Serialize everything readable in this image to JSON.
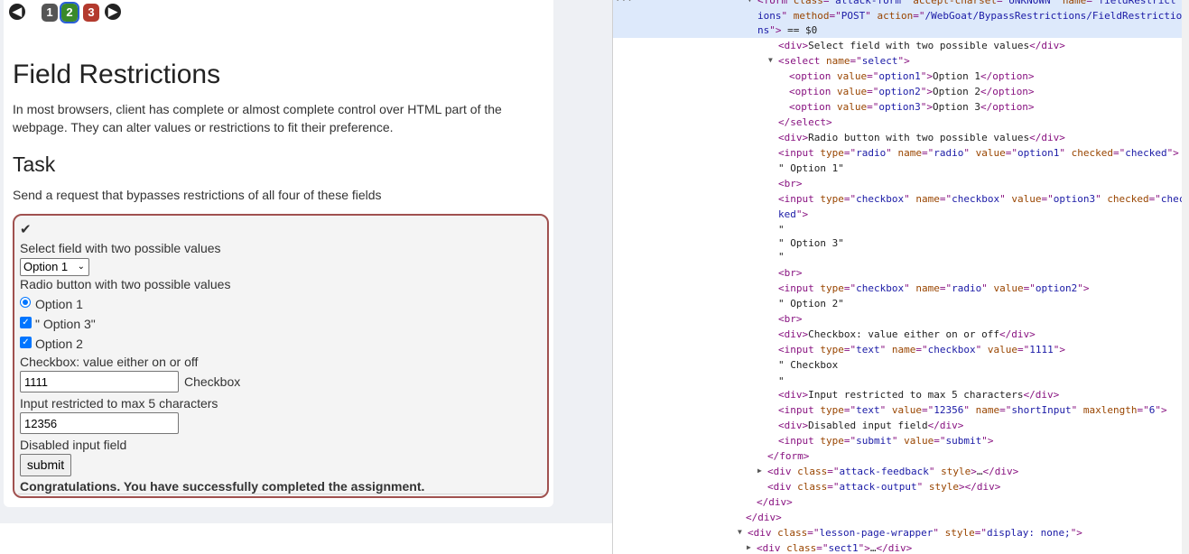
{
  "lesson": {
    "pages": [
      "1",
      "2",
      "3"
    ],
    "title": "Field Restrictions",
    "intro": "In most browsers, client has complete or almost complete control over HTML part of the webpage. They can alter values or restrictions to fit their preference.",
    "task_heading": "Task",
    "task_desc": "Send a request that bypasses restrictions of all four of these fields"
  },
  "form": {
    "check_mark": "✔",
    "select_label": "Select field with two possible values",
    "select_value": "Option 1",
    "radio_label": "Radio button with two possible values",
    "radio_option_label": "Option 1",
    "checkbox1_label": "\" Option 3\"",
    "checkbox2_label": "Option 2",
    "text_label": "Checkbox: value either on or off",
    "text_value": "1111",
    "text_suffix": "Checkbox",
    "short_label": "Input restricted to max 5 characters",
    "short_value": "12356",
    "disabled_label": "Disabled input field",
    "submit_label": "submit",
    "feedback": "Congratulations. You have successfully completed the assignment."
  },
  "devtools": {
    "lines": [
      {
        "p": [
          [
            "tg",
            "<form "
          ],
          [
            "an",
            "class"
          ],
          [
            "tg",
            "=\""
          ],
          [
            "av",
            "attack-form"
          ],
          [
            "tg",
            "\" "
          ],
          [
            "an",
            "accept-charset"
          ],
          [
            "tg",
            "=\""
          ],
          [
            "av",
            "UNKNOWN"
          ],
          [
            "tg",
            "\" "
          ],
          [
            "an",
            "name"
          ],
          [
            "tg",
            "=\""
          ],
          [
            "av",
            "fieldRestrict"
          ]
        ]
      },
      {
        "p": [
          [
            "av",
            "ions"
          ],
          [
            "tg",
            "\" "
          ],
          [
            "an",
            "method"
          ],
          [
            "tg",
            "=\""
          ],
          [
            "av",
            "POST"
          ],
          [
            "tg",
            "\" "
          ],
          [
            "an",
            "action"
          ],
          [
            "tg",
            "=\""
          ],
          [
            "av",
            "/WebGoat/BypassRestrictions/FieldRestrictio"
          ]
        ]
      },
      {
        "p": [
          [
            "av",
            "ns"
          ],
          [
            "tg",
            "\">"
          ],
          [
            "tx",
            " == $0"
          ]
        ]
      },
      {
        "p": [
          [
            "tg",
            "<div>"
          ],
          [
            "tx",
            "Select field with two possible values"
          ],
          [
            "tg",
            "</div>"
          ]
        ]
      },
      {
        "p": [
          [
            "tg",
            "<select "
          ],
          [
            "an",
            "name"
          ],
          [
            "tg",
            "=\""
          ],
          [
            "av",
            "select"
          ],
          [
            "tg",
            "\">"
          ]
        ]
      },
      {
        "p": [
          [
            "tg",
            "<option "
          ],
          [
            "an",
            "value"
          ],
          [
            "tg",
            "=\""
          ],
          [
            "av",
            "option1"
          ],
          [
            "tg",
            "\">"
          ],
          [
            "tx",
            "Option 1"
          ],
          [
            "tg",
            "</option>"
          ]
        ]
      },
      {
        "p": [
          [
            "tg",
            "<option "
          ],
          [
            "an",
            "value"
          ],
          [
            "tg",
            "=\""
          ],
          [
            "av",
            "option2"
          ],
          [
            "tg",
            "\">"
          ],
          [
            "tx",
            "Option 2"
          ],
          [
            "tg",
            "</option>"
          ]
        ]
      },
      {
        "p": [
          [
            "tg",
            "<option "
          ],
          [
            "an",
            "value"
          ],
          [
            "tg",
            "=\""
          ],
          [
            "av",
            "option3"
          ],
          [
            "tg",
            "\">"
          ],
          [
            "tx",
            "Option 3"
          ],
          [
            "tg",
            "</option>"
          ]
        ]
      },
      {
        "p": [
          [
            "tg",
            "</select>"
          ]
        ]
      },
      {
        "p": [
          [
            "tg",
            "<div>"
          ],
          [
            "tx",
            "Radio button with two possible values"
          ],
          [
            "tg",
            "</div>"
          ]
        ]
      },
      {
        "p": [
          [
            "tg",
            "<input "
          ],
          [
            "an",
            "type"
          ],
          [
            "tg",
            "=\""
          ],
          [
            "av",
            "radio"
          ],
          [
            "tg",
            "\" "
          ],
          [
            "an",
            "name"
          ],
          [
            "tg",
            "=\""
          ],
          [
            "av",
            "radio"
          ],
          [
            "tg",
            "\" "
          ],
          [
            "an",
            "value"
          ],
          [
            "tg",
            "=\""
          ],
          [
            "av",
            "option1"
          ],
          [
            "tg",
            "\" "
          ],
          [
            "an",
            "checked"
          ],
          [
            "tg",
            "=\""
          ],
          [
            "av",
            "checked"
          ],
          [
            "tg",
            "\">"
          ]
        ]
      },
      {
        "p": [
          [
            "tx",
            "\" Option 1\""
          ]
        ]
      },
      {
        "p": [
          [
            "tg",
            "<br>"
          ]
        ]
      },
      {
        "p": [
          [
            "tg",
            "<input "
          ],
          [
            "an",
            "type"
          ],
          [
            "tg",
            "=\""
          ],
          [
            "av",
            "checkbox"
          ],
          [
            "tg",
            "\" "
          ],
          [
            "an",
            "name"
          ],
          [
            "tg",
            "=\""
          ],
          [
            "av",
            "checkbox"
          ],
          [
            "tg",
            "\" "
          ],
          [
            "an",
            "value"
          ],
          [
            "tg",
            "=\""
          ],
          [
            "av",
            "option3"
          ],
          [
            "tg",
            "\" "
          ],
          [
            "an",
            "checked"
          ],
          [
            "tg",
            "=\""
          ],
          [
            "av",
            "chec"
          ]
        ]
      },
      {
        "p": [
          [
            "av",
            "ked"
          ],
          [
            "tg",
            "\">"
          ]
        ]
      },
      {
        "p": [
          [
            "tx",
            "\""
          ]
        ]
      },
      {
        "p": [
          [
            "tx",
            "\" Option 3\""
          ]
        ]
      },
      {
        "p": [
          [
            "tx",
            "\""
          ]
        ]
      },
      {
        "p": [
          [
            "tg",
            "<br>"
          ]
        ]
      },
      {
        "p": [
          [
            "tg",
            "<input "
          ],
          [
            "an",
            "type"
          ],
          [
            "tg",
            "=\""
          ],
          [
            "av",
            "checkbox"
          ],
          [
            "tg",
            "\" "
          ],
          [
            "an",
            "name"
          ],
          [
            "tg",
            "=\""
          ],
          [
            "av",
            "radio"
          ],
          [
            "tg",
            "\" "
          ],
          [
            "an",
            "value"
          ],
          [
            "tg",
            "=\""
          ],
          [
            "av",
            "option2"
          ],
          [
            "tg",
            "\">"
          ]
        ]
      },
      {
        "p": [
          [
            "tx",
            "\" Option 2\""
          ]
        ]
      },
      {
        "p": [
          [
            "tg",
            "<br>"
          ]
        ]
      },
      {
        "p": [
          [
            "tg",
            "<div>"
          ],
          [
            "tx",
            "Checkbox: value either on or off"
          ],
          [
            "tg",
            "</div>"
          ]
        ]
      },
      {
        "p": [
          [
            "tg",
            "<input "
          ],
          [
            "an",
            "type"
          ],
          [
            "tg",
            "=\""
          ],
          [
            "av",
            "text"
          ],
          [
            "tg",
            "\" "
          ],
          [
            "an",
            "name"
          ],
          [
            "tg",
            "=\""
          ],
          [
            "av",
            "checkbox"
          ],
          [
            "tg",
            "\" "
          ],
          [
            "an",
            "value"
          ],
          [
            "tg",
            "=\""
          ],
          [
            "av",
            "1111"
          ],
          [
            "tg",
            "\">"
          ]
        ]
      },
      {
        "p": [
          [
            "tx",
            "\" Checkbox"
          ]
        ]
      },
      {
        "p": [
          [
            "tx",
            "\""
          ]
        ]
      },
      {
        "p": [
          [
            "tg",
            "<div>"
          ],
          [
            "tx",
            "Input restricted to max 5 characters"
          ],
          [
            "tg",
            "</div>"
          ]
        ]
      },
      {
        "p": [
          [
            "tg",
            "<input "
          ],
          [
            "an",
            "type"
          ],
          [
            "tg",
            "=\""
          ],
          [
            "av",
            "text"
          ],
          [
            "tg",
            "\" "
          ],
          [
            "an",
            "value"
          ],
          [
            "tg",
            "=\""
          ],
          [
            "av",
            "12356"
          ],
          [
            "tg",
            "\" "
          ],
          [
            "an",
            "name"
          ],
          [
            "tg",
            "=\""
          ],
          [
            "av",
            "shortInput"
          ],
          [
            "tg",
            "\" "
          ],
          [
            "an",
            "maxlength"
          ],
          [
            "tg",
            "=\""
          ],
          [
            "av",
            "6"
          ],
          [
            "tg",
            "\">"
          ]
        ]
      },
      {
        "p": [
          [
            "tg",
            "<div>"
          ],
          [
            "tx",
            "Disabled input field"
          ],
          [
            "tg",
            "</div>"
          ]
        ]
      },
      {
        "p": [
          [
            "tg",
            "<input "
          ],
          [
            "an",
            "type"
          ],
          [
            "tg",
            "=\""
          ],
          [
            "av",
            "submit"
          ],
          [
            "tg",
            "\" "
          ],
          [
            "an",
            "value"
          ],
          [
            "tg",
            "=\""
          ],
          [
            "av",
            "submit"
          ],
          [
            "tg",
            "\">"
          ]
        ]
      },
      {
        "p": [
          [
            "tg",
            "</form>"
          ]
        ]
      },
      {
        "p": [
          [
            "tg",
            "<div "
          ],
          [
            "an",
            "class"
          ],
          [
            "tg",
            "=\""
          ],
          [
            "av",
            "attack-feedback"
          ],
          [
            "tg",
            "\" "
          ],
          [
            "an",
            "style"
          ],
          [
            "tg",
            ">"
          ],
          [
            "tx",
            "…"
          ],
          [
            "tg",
            "</div>"
          ]
        ]
      },
      {
        "p": [
          [
            "tg",
            "<div "
          ],
          [
            "an",
            "class"
          ],
          [
            "tg",
            "=\""
          ],
          [
            "av",
            "attack-output"
          ],
          [
            "tg",
            "\" "
          ],
          [
            "an",
            "style"
          ],
          [
            "tg",
            "></div>"
          ]
        ]
      },
      {
        "p": [
          [
            "tg",
            "</div>"
          ]
        ]
      },
      {
        "p": [
          [
            "tg",
            "</div>"
          ]
        ]
      },
      {
        "p": [
          [
            "tg",
            "<div "
          ],
          [
            "an",
            "class"
          ],
          [
            "tg",
            "=\""
          ],
          [
            "av",
            "lesson-page-wrapper"
          ],
          [
            "tg",
            "\" "
          ],
          [
            "an",
            "style"
          ],
          [
            "tg",
            "=\""
          ],
          [
            "av",
            "display: none;"
          ],
          [
            "tg",
            "\">"
          ]
        ]
      },
      {
        "p": [
          [
            "tg",
            "<div "
          ],
          [
            "an",
            "class"
          ],
          [
            "tg",
            "=\""
          ],
          [
            "av",
            "sect1"
          ],
          [
            "tg",
            "\">"
          ],
          [
            "tx",
            "…"
          ],
          [
            "tg",
            "</div>"
          ]
        ]
      }
    ]
  },
  "colors": {
    "page2": "#3a8a2a",
    "page3": "#b33a2e",
    "page1": "#555555",
    "box_border": "#a0514f",
    "accent": "#0075ff"
  }
}
